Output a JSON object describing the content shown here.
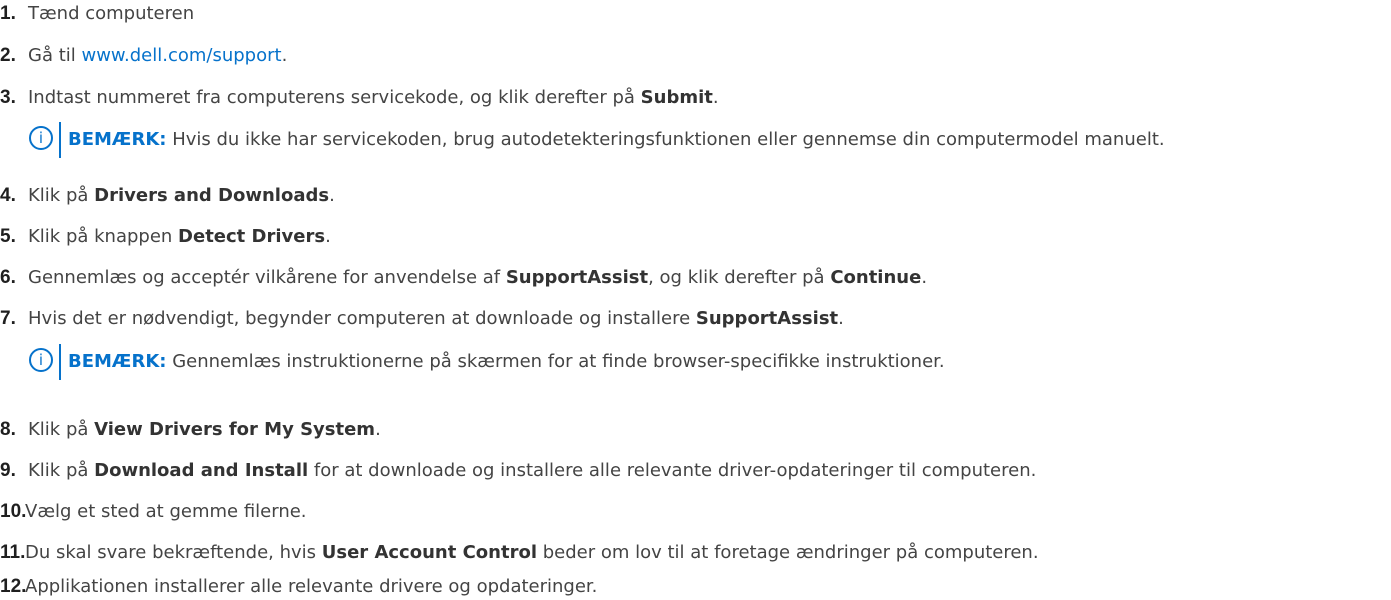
{
  "steps": [
    {
      "num": "1.",
      "parts": [
        {
          "t": "Tænd computeren"
        }
      ]
    },
    {
      "num": "2.",
      "parts": [
        {
          "t": "Gå til "
        },
        {
          "t": "www.dell.com/support",
          "link": true
        },
        {
          "t": "."
        }
      ]
    },
    {
      "num": "3.",
      "parts": [
        {
          "t": "Indtast nummeret fra computerens servicekode, og klik derefter på "
        },
        {
          "t": "Submit",
          "bold": true
        },
        {
          "t": "."
        }
      ]
    },
    {
      "num": "4.",
      "parts": [
        {
          "t": "Klik på "
        },
        {
          "t": "Drivers and Downloads",
          "bold": true
        },
        {
          "t": "."
        }
      ]
    },
    {
      "num": "5.",
      "parts": [
        {
          "t": "Klik på knappen "
        },
        {
          "t": "Detect Drivers",
          "bold": true
        },
        {
          "t": "."
        }
      ]
    },
    {
      "num": "6.",
      "parts": [
        {
          "t": "Gennemlæs og acceptér vilkårene for anvendelse af "
        },
        {
          "t": "SupportAssist",
          "bold": true
        },
        {
          "t": ", og klik derefter på "
        },
        {
          "t": "Continue",
          "bold": true
        },
        {
          "t": "."
        }
      ]
    },
    {
      "num": "7.",
      "parts": [
        {
          "t": "Hvis det er nødvendigt, begynder computeren at downloade og installere "
        },
        {
          "t": "SupportAssist",
          "bold": true
        },
        {
          "t": "."
        }
      ]
    },
    {
      "num": "8.",
      "parts": [
        {
          "t": "Klik på "
        },
        {
          "t": "View Drivers for My System",
          "bold": true
        },
        {
          "t": "."
        }
      ]
    },
    {
      "num": "9.",
      "parts": [
        {
          "t": "Klik på "
        },
        {
          "t": "Download and Install",
          "bold": true
        },
        {
          "t": " for at downloade og installere alle relevante driver-opdateringer til computeren."
        }
      ]
    },
    {
      "num": "10.",
      "parts": [
        {
          "t": "Vælg et sted at gemme filerne."
        }
      ]
    },
    {
      "num": "11.",
      "parts": [
        {
          "t": "Du skal svare bekræftende, hvis "
        },
        {
          "t": "User Account Control",
          "bold": true
        },
        {
          "t": " beder om lov til at foretage ændringer på computeren."
        }
      ]
    },
    {
      "num": "12.",
      "parts": [
        {
          "t": "Applikationen installerer alle relevante drivere og opdateringer."
        }
      ]
    }
  ],
  "notes": [
    {
      "icon": "info-icon",
      "label": "BEMÆRK:",
      "text": " Hvis du ikke har servicekoden, brug autodetekteringsfunktionen eller gennemse din computermodel manuelt."
    },
    {
      "icon": "info-icon",
      "label": "BEMÆRK:",
      "text": " Gennemlæs instruktionerne på skærmen for at finde browser-specifikke instruktioner."
    }
  ],
  "colors": {
    "link": "#0672cb",
    "note_accent": "#0672cb",
    "text": "#444444",
    "number": "#1f1f1f"
  }
}
